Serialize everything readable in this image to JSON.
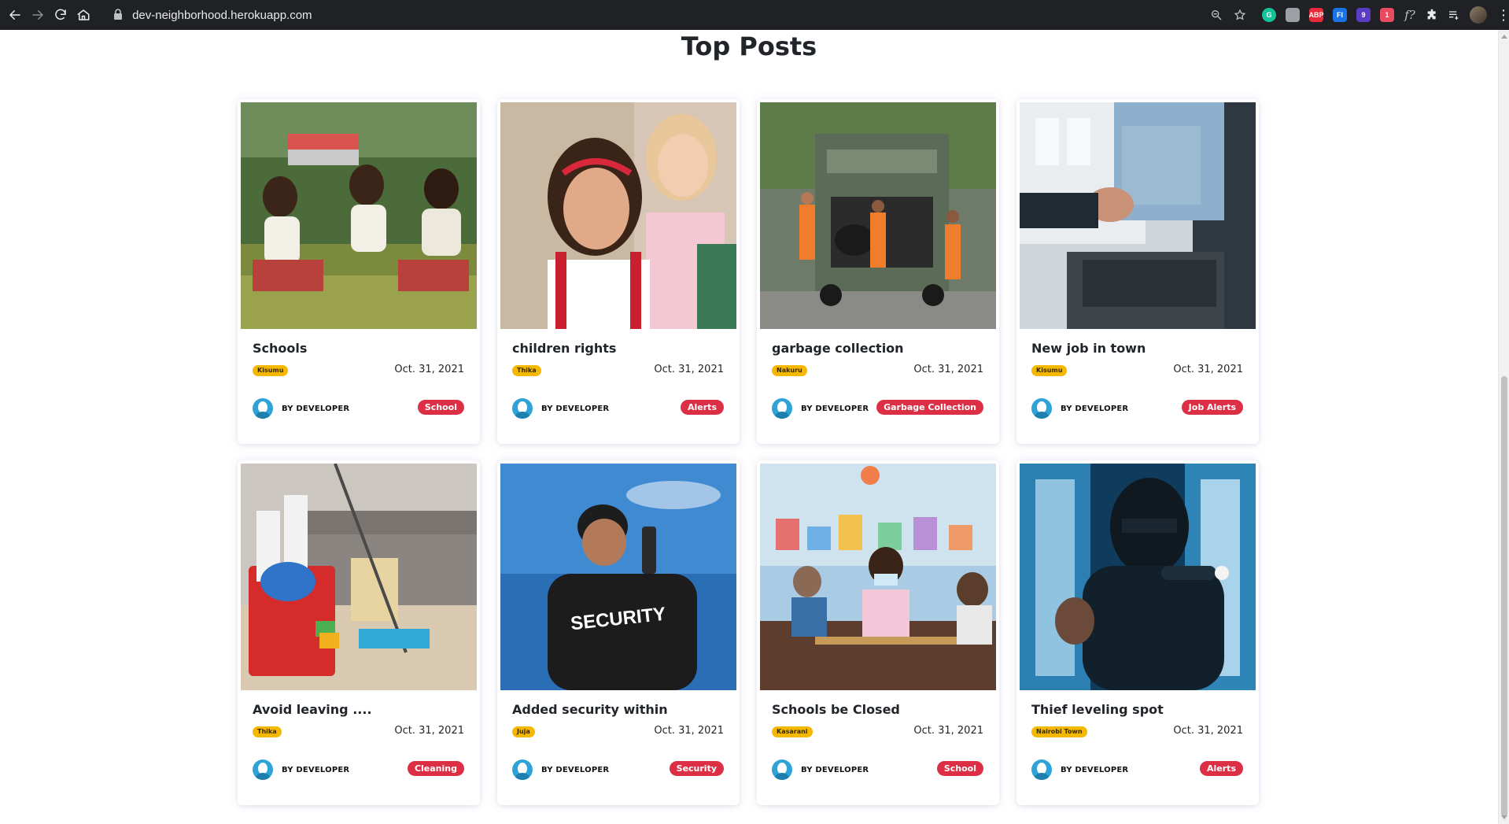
{
  "browser": {
    "url": "dev-neighborhood.herokuapp.com",
    "extensions": [
      {
        "name": "grammarly",
        "label": "G",
        "color": "#15c39a"
      },
      {
        "name": "ext-gray",
        "label": "",
        "color": "#9aa0a6"
      },
      {
        "name": "adblock",
        "label": "ABP",
        "color": "#e8293a"
      },
      {
        "name": "ext-fi",
        "label": "FI",
        "color": "#1a73e8"
      },
      {
        "name": "ext-purple",
        "label": "9",
        "color": "#5b3cc4"
      },
      {
        "name": "ext-red",
        "label": "1",
        "color": "#e84a5f"
      }
    ]
  },
  "page": {
    "title": "Top Posts"
  },
  "colors": {
    "location_badge": "#f5b800",
    "category_badge": "#dc2f45"
  },
  "posts": [
    {
      "title": "Schools",
      "location": "Kisumu",
      "date": "Oct. 31, 2021",
      "author": "BY DEVELOPER",
      "category": "School",
      "image": "children-playing-outdoors"
    },
    {
      "title": "children rights",
      "location": "Thika",
      "date": "Oct. 31, 2021",
      "author": "BY DEVELOPER",
      "category": "Alerts",
      "image": "smiling-schoolgirls"
    },
    {
      "title": "garbage collection",
      "location": "Nakuru",
      "date": "Oct. 31, 2021",
      "author": "BY DEVELOPER",
      "category": "Garbage Collection",
      "image": "garbage-truck-workers"
    },
    {
      "title": "New job in town",
      "location": "Kisumu",
      "date": "Oct. 31, 2021",
      "author": "BY DEVELOPER",
      "category": "Job Alerts",
      "image": "business-handshake"
    },
    {
      "title": "Avoid leaving ....",
      "location": "Thika",
      "date": "Oct. 31, 2021",
      "author": "BY DEVELOPER",
      "category": "Cleaning",
      "image": "cleaning-supplies-bucket"
    },
    {
      "title": "Added security within",
      "location": "Juja",
      "date": "Oct. 31, 2021",
      "author": "BY DEVELOPER",
      "category": "Security",
      "image": "security-guard-radio"
    },
    {
      "title": "Schools be Closed",
      "location": "Kasarani",
      "date": "Oct. 31, 2021",
      "author": "BY DEVELOPER",
      "category": "School",
      "image": "masked-kids-classroom"
    },
    {
      "title": "Thief leveling spot",
      "location": "Nairobi Town",
      "date": "Oct. 31, 2021",
      "author": "BY DEVELOPER",
      "category": "Alerts",
      "image": "burglar-with-flashlight"
    }
  ]
}
